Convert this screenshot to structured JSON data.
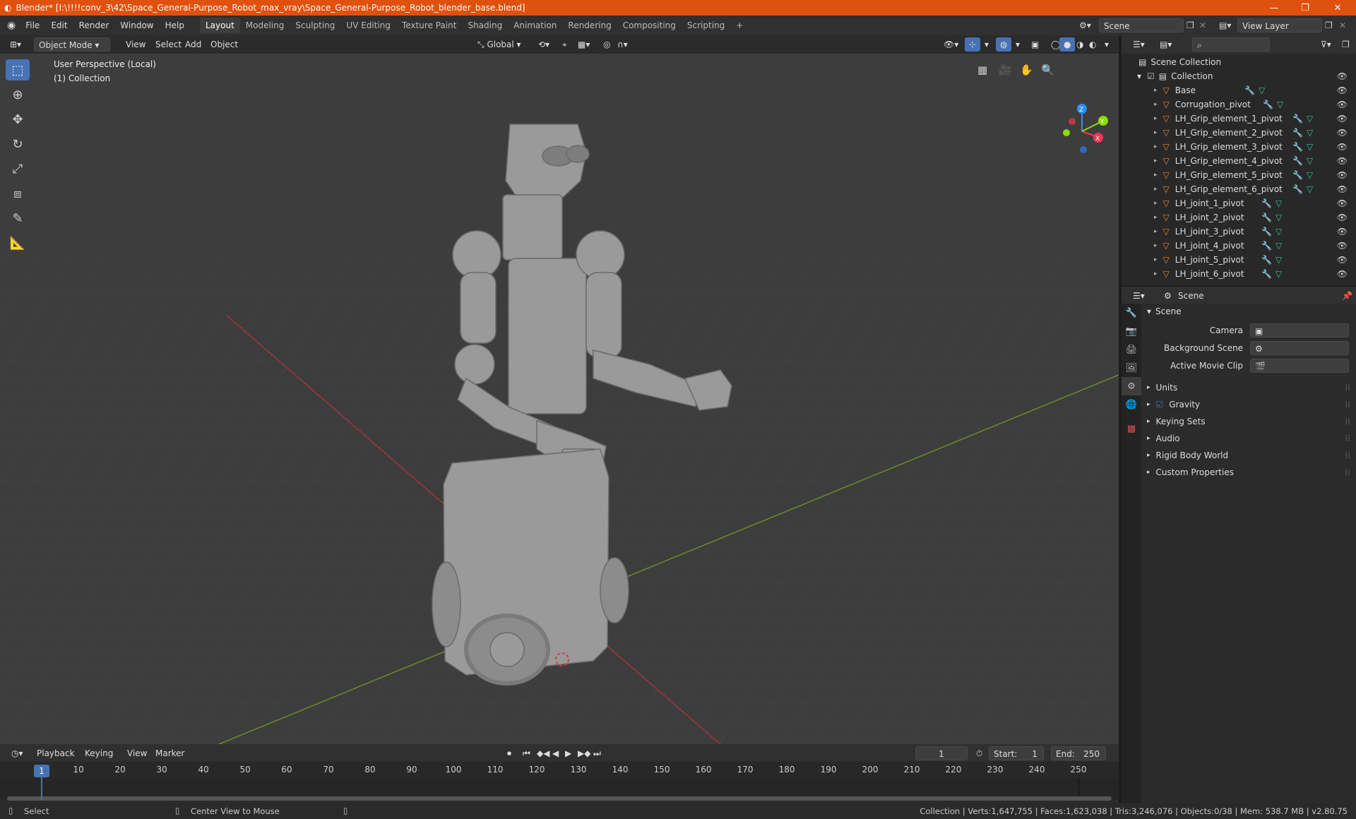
{
  "window": {
    "title": "Blender* [I:\\!!!!conv_3\\42\\Space_General-Purpose_Robot_max_vray\\Space_General-Purpose_Robot_blender_base.blend]"
  },
  "menu": [
    "File",
    "Edit",
    "Render",
    "Window",
    "Help"
  ],
  "workspaces": [
    "Layout",
    "Modeling",
    "Sculpting",
    "UV Editing",
    "Texture Paint",
    "Shading",
    "Animation",
    "Rendering",
    "Compositing",
    "Scripting"
  ],
  "scene_name": "Scene",
  "view_layer": "View Layer",
  "viewport_header": {
    "mode": "Object Mode",
    "view": "View",
    "select": "Select",
    "add": "Add",
    "object": "Object",
    "orientation": "Global"
  },
  "viewport": {
    "perspective": "User Perspective (Local)",
    "collection": "(1) Collection"
  },
  "outliner": {
    "root": "Scene Collection",
    "collection": "Collection",
    "items": [
      "Base",
      "Corrugation_pivot",
      "LH_Grip_element_1_pivot",
      "LH_Grip_element_2_pivot",
      "LH_Grip_element_3_pivot",
      "LH_Grip_element_4_pivot",
      "LH_Grip_element_5_pivot",
      "LH_Grip_element_6_pivot",
      "LH_joint_1_pivot",
      "LH_joint_2_pivot",
      "LH_joint_3_pivot",
      "LH_joint_4_pivot",
      "LH_joint_5_pivot",
      "LH_joint_6_pivot"
    ]
  },
  "properties": {
    "context": "Scene",
    "panel": "Scene",
    "camera_label": "Camera",
    "bg_scene_label": "Background Scene",
    "movie_clip_label": "Active Movie Clip",
    "sections": [
      "Units",
      "Gravity",
      "Keying Sets",
      "Audio",
      "Rigid Body World",
      "Custom Properties"
    ]
  },
  "timeline": {
    "menus": [
      "Playback",
      "Keying",
      "View",
      "Marker"
    ],
    "current_frame": "1",
    "start_label": "Start:",
    "start": "1",
    "end_label": "End:",
    "end": "250",
    "ticks": [
      "1",
      "10",
      "20",
      "30",
      "40",
      "50",
      "60",
      "70",
      "80",
      "90",
      "100",
      "110",
      "120",
      "130",
      "140",
      "150",
      "160",
      "170",
      "180",
      "190",
      "200",
      "210",
      "220",
      "230",
      "240",
      "250"
    ]
  },
  "status": {
    "select": "Select",
    "center": "Center View to Mouse",
    "stats": "Collection | Verts:1,647,755 | Faces:1,623,038 | Tris:3,246,076 | Objects:0/38 | Mem: 538.7 MB | v2.80.75"
  },
  "colors": {
    "titlebar": "#e0500f",
    "accent": "#4772b3",
    "x_axis": "#ff3352",
    "y_axis": "#8bdc00",
    "z_axis": "#2890ff"
  }
}
